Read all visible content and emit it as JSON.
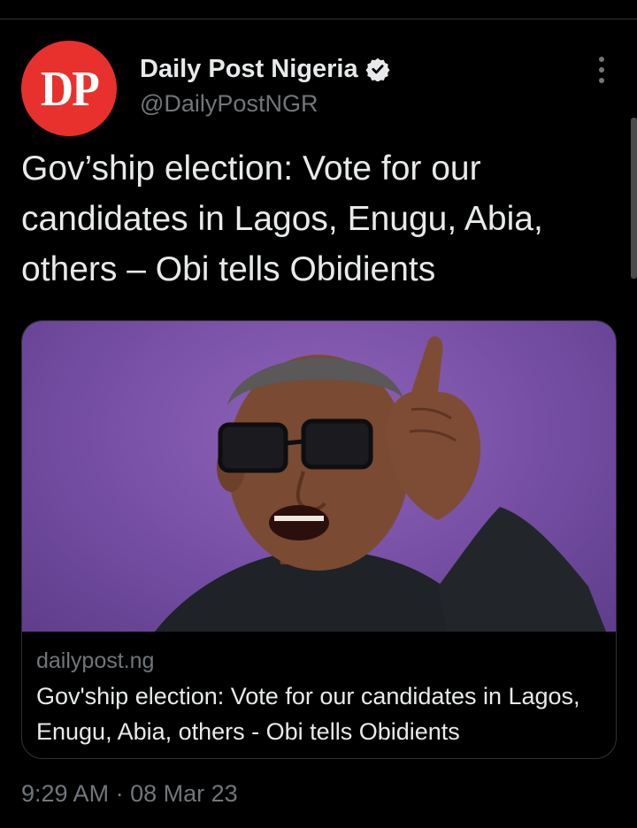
{
  "author": {
    "avatar_text": "DP",
    "display_name": "Daily Post Nigeria",
    "handle": "@DailyPostNGR",
    "verified": true
  },
  "tweet": {
    "text": "Gov’ship election: Vote for our candidates in Lagos, Enugu, Abia, others – Obi tells Obidients",
    "time": "9:29 AM",
    "separator": "·",
    "date": "08 Mar 23"
  },
  "card": {
    "domain": "dailypost.ng",
    "title": "Gov'ship election: Vote for our candidates in Lagos, Enugu, Abia, others - Obi tells Obidients"
  },
  "icons": {
    "verified": "verified-badge-icon",
    "more": "more-options-icon"
  },
  "colors": {
    "background": "#000000",
    "primary_text": "#e7e9ea",
    "secondary_text": "#71767b",
    "avatar_red": "#e8312c",
    "card_border": "#2f3336",
    "photo_backdrop": "#7a52a8"
  }
}
